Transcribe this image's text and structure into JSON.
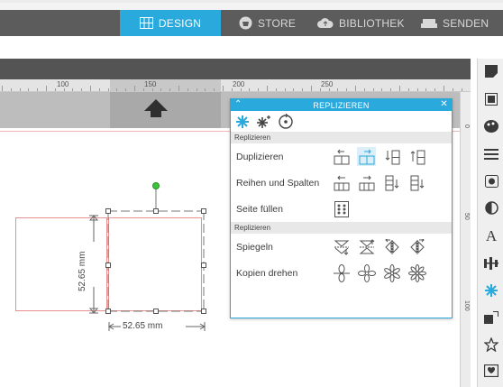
{
  "nav": {
    "tabs": [
      {
        "label": "DESIGN",
        "active": true,
        "icon": "grid-icon"
      },
      {
        "label": "STORE",
        "active": false,
        "icon": "shop-icon"
      },
      {
        "label": "BIBLIOTHEK",
        "active": false,
        "icon": "cloud-icon"
      },
      {
        "label": "SENDEN",
        "active": false,
        "icon": "send-icon"
      }
    ]
  },
  "ruler": {
    "labels": [
      "100",
      "150",
      "200",
      "250"
    ],
    "vlabels": [
      "0",
      "50",
      "100"
    ]
  },
  "shape": {
    "height_label": "52.65 mm",
    "width_label": "52.65 mm"
  },
  "panel": {
    "title": "REPLIZIEREN",
    "section1": "Replizieren",
    "section2": "Replizieren",
    "rows": {
      "duplicate": "Duplizieren",
      "rows_cols": "Reihen und Spalten",
      "fill_page": "Seite füllen",
      "mirror": "Spiegeln",
      "rotate_copies": "Kopien drehen"
    }
  },
  "colors": {
    "accent": "#2aa9dc",
    "navbar": "#5c5c5c",
    "shape_stroke": "#e88f8f",
    "rotate_handle": "#3cc43c"
  },
  "sidebar": {
    "icons": [
      "shape-icon",
      "pixscan-icon",
      "palette-icon",
      "lines-icon",
      "image-icon",
      "contrast-icon",
      "text-icon",
      "align-icon",
      "replicate-icon",
      "offset-icon",
      "star-icon",
      "library-icon"
    ],
    "text_icon_label": "A"
  }
}
